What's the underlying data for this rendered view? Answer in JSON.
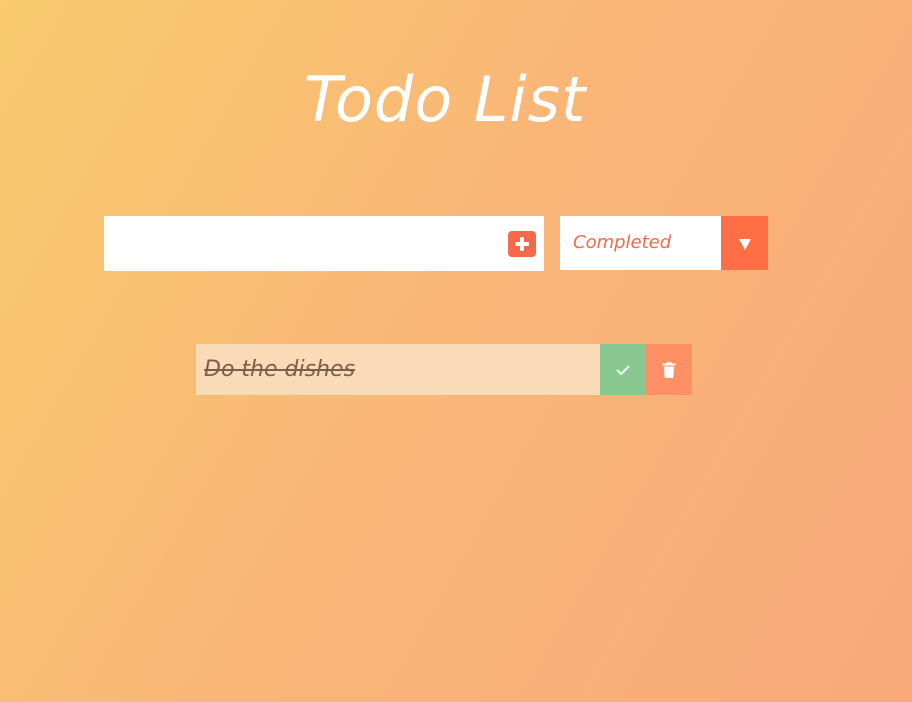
{
  "app": {
    "title": "Todo List"
  },
  "form": {
    "input_value": "",
    "input_placeholder": "",
    "add_icon": "plus-square-icon",
    "filter": {
      "selected": "Completed",
      "arrow_icon": "caret-down-icon"
    }
  },
  "todos": [
    {
      "text": "Do the dishes",
      "completed": true,
      "complete_icon": "check-icon",
      "delete_icon": "trash-icon"
    }
  ],
  "colors": {
    "accent": "#f4694a",
    "filter_arrow_bg": "#ff6e45",
    "item_bg": "#fadbb8",
    "complete_bg": "#88c890",
    "delete_bg": "#ff8f64",
    "gradient_start": "#f8cb6d",
    "gradient_end": "#f9a97a"
  }
}
